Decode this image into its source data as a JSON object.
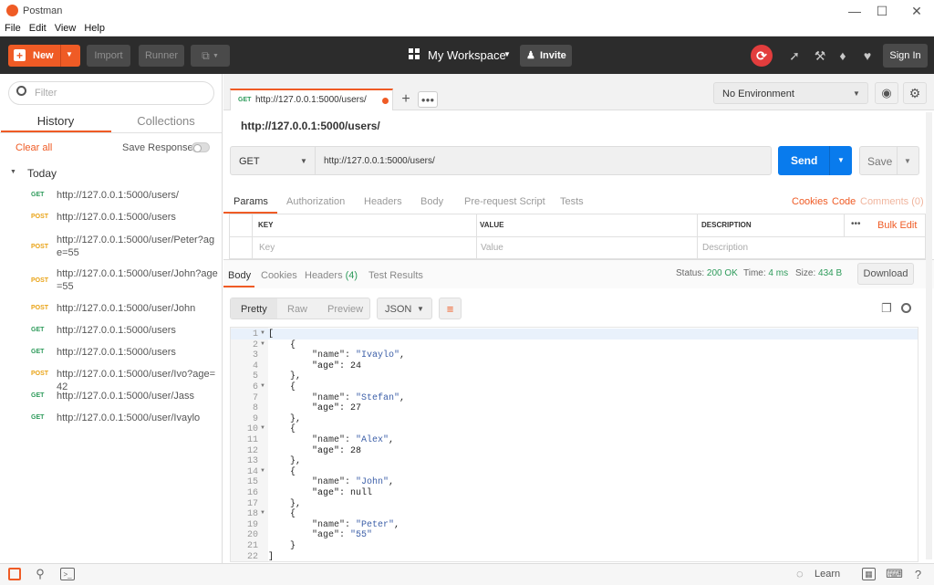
{
  "window": {
    "title": "Postman"
  },
  "menu": [
    "File",
    "Edit",
    "View",
    "Help"
  ],
  "header": {
    "new_label": "New",
    "import_label": "Import",
    "runner_label": "Runner",
    "workspace_label": "My Workspace",
    "invite_label": "Invite",
    "signin_label": "Sign In"
  },
  "sidebar": {
    "filter_placeholder": "Filter",
    "tabs": [
      "History",
      "Collections"
    ],
    "clear_all": "Clear all",
    "save_responses": "Save Responses",
    "group": "Today",
    "items": [
      {
        "method": "GET",
        "url": "http://127.0.0.1:5000/users/"
      },
      {
        "method": "POST",
        "url": "http://127.0.0.1:5000/users"
      },
      {
        "method": "POST",
        "url": "http://127.0.0.1:5000/user/Peter?age=55"
      },
      {
        "method": "POST",
        "url": "http://127.0.0.1:5000/user/John?age=55"
      },
      {
        "method": "POST",
        "url": "http://127.0.0.1:5000/user/John"
      },
      {
        "method": "GET",
        "url": "http://127.0.0.1:5000/users"
      },
      {
        "method": "GET",
        "url": "http://127.0.0.1:5000/users"
      },
      {
        "method": "POST",
        "url": "http://127.0.0.1:5000/user/Ivo?age=42"
      },
      {
        "method": "GET",
        "url": "http://127.0.0.1:5000/user/Jass"
      },
      {
        "method": "GET",
        "url": "http://127.0.0.1:5000/user/Ivaylo"
      }
    ]
  },
  "request": {
    "tab_method": "GET",
    "tab_url": "http://127.0.0.1:5000/users/",
    "title": "http://127.0.0.1:5000/users/",
    "method": "GET",
    "url": "http://127.0.0.1:5000/users/",
    "send_label": "Send",
    "save_label": "Save",
    "environment": "No Environment",
    "tabs": [
      "Params",
      "Authorization",
      "Headers",
      "Body",
      "Pre-request Script",
      "Tests"
    ],
    "links": {
      "cookies": "Cookies",
      "code": "Code",
      "comments": "Comments (0)"
    },
    "params_headers": {
      "key": "KEY",
      "value": "VALUE",
      "description": "DESCRIPTION",
      "bulk_edit": "Bulk Edit",
      "more": "•••"
    },
    "params_placeholders": {
      "key": "Key",
      "value": "Value",
      "description": "Description"
    }
  },
  "response": {
    "tabs": {
      "body": "Body",
      "cookies": "Cookies",
      "headers": "Headers",
      "headers_count": "(4)",
      "tests": "Test Results"
    },
    "status_label": "Status:",
    "status": "200 OK",
    "time_label": "Time:",
    "time": "4 ms",
    "size_label": "Size:",
    "size": "434 B",
    "download_label": "Download",
    "view_modes": [
      "Pretty",
      "Raw",
      "Preview"
    ],
    "format": "JSON",
    "code_lines": [
      "[",
      "    {",
      "        \"name\": \"Ivaylo\",",
      "        \"age\": 24",
      "    },",
      "    {",
      "        \"name\": \"Stefan\",",
      "        \"age\": 27",
      "    },",
      "    {",
      "        \"name\": \"Alex\",",
      "        \"age\": 28",
      "    },",
      "    {",
      "        \"name\": \"John\",",
      "        \"age\": null",
      "    },",
      "    {",
      "        \"name\": \"Peter\",",
      "        \"age\": \"55\"",
      "    }",
      "]"
    ]
  },
  "footer": {
    "learn_label": "Learn"
  },
  "colors": {
    "accent": "#ef5b25",
    "send": "#097bed",
    "get": "#2e9b5b",
    "post": "#e9a316",
    "status_ok": "#2e9b5b"
  }
}
